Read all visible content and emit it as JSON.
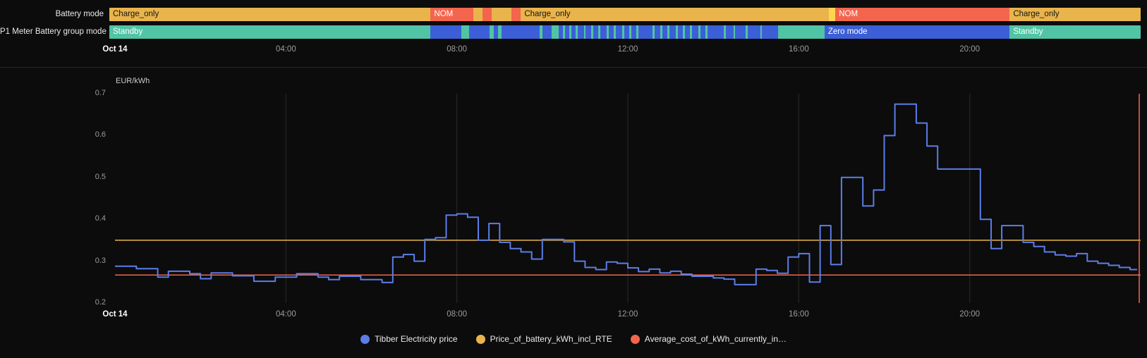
{
  "colors": {
    "background": "#0c0c0c",
    "amber": "#e9b44c",
    "amber_bright": "#ffd54f",
    "red": "#f3654d",
    "teal": "#50c4a4",
    "blue": "#3c5fd7",
    "price_line": "#5b7de8",
    "grid": "#2a2a2a",
    "axis_text": "#9c9c9c",
    "bright_text": "#ffffff"
  },
  "timelines": [
    {
      "label": "Battery mode",
      "segments": [
        {
          "s": 0,
          "e": 31.15,
          "c": "amber",
          "label": "Charge_only",
          "dark": true
        },
        {
          "s": 31.15,
          "e": 35.3,
          "c": "red",
          "label": "NOM"
        },
        {
          "s": 35.3,
          "e": 36.2,
          "c": "amber"
        },
        {
          "s": 36.2,
          "e": 37.1,
          "c": "red"
        },
        {
          "s": 37.1,
          "e": 39,
          "c": "amber"
        },
        {
          "s": 39,
          "e": 39.9,
          "c": "red"
        },
        {
          "s": 39.9,
          "e": 69.8,
          "c": "amber",
          "label": "Charge_only",
          "dark": true
        },
        {
          "s": 69.8,
          "e": 70.4,
          "c": "amber_bright"
        },
        {
          "s": 70.4,
          "e": 87.3,
          "c": "red",
          "label": "NOM"
        },
        {
          "s": 87.3,
          "e": 100,
          "c": "amber",
          "label": "Charge_only",
          "dark": true
        }
      ]
    },
    {
      "label": "P1 Meter Battery group mode",
      "segments": [
        {
          "s": 0,
          "e": 31.15,
          "c": "teal",
          "label": "Standby"
        },
        {
          "s": 31.15,
          "e": 64.85,
          "c": "blue"
        },
        {
          "s": 64.85,
          "e": 69.35,
          "c": "teal"
        },
        {
          "s": 69.35,
          "e": 87.3,
          "c": "blue",
          "label": "Zero mode"
        },
        {
          "s": 87.3,
          "e": 100,
          "c": "teal",
          "label": "Standby"
        }
      ],
      "stripes": [
        [
          34.1,
          34.9
        ],
        [
          36.9,
          37.3
        ],
        [
          37.7,
          38.0
        ],
        [
          41.7,
          42.0
        ],
        [
          42.9,
          43.6
        ],
        [
          44.0,
          44.2
        ],
        [
          44.6,
          44.8
        ],
        [
          45.2,
          45.4
        ],
        [
          46.0,
          46.2
        ],
        [
          46.7,
          46.9
        ],
        [
          47.4,
          47.6
        ],
        [
          48.2,
          48.4
        ],
        [
          48.9,
          49.1
        ],
        [
          49.7,
          49.9
        ],
        [
          50.4,
          50.6
        ],
        [
          51.1,
          51.3
        ],
        [
          52.7,
          52.9
        ],
        [
          53.4,
          53.6
        ],
        [
          54.1,
          54.3
        ],
        [
          54.9,
          55.1
        ],
        [
          55.6,
          55.8
        ],
        [
          56.3,
          56.5
        ],
        [
          57.1,
          57.3
        ],
        [
          57.8,
          58.0
        ],
        [
          59.6,
          59.8
        ],
        [
          60.5,
          60.7
        ],
        [
          61.7,
          61.9
        ],
        [
          63.1,
          63.3
        ]
      ]
    }
  ],
  "time_axis": {
    "ticks": [
      {
        "pos": 0,
        "label": "Oct 14",
        "bold": true
      },
      {
        "pos": 16.667,
        "label": "04:00"
      },
      {
        "pos": 33.333,
        "label": "08:00"
      },
      {
        "pos": 50,
        "label": "12:00"
      },
      {
        "pos": 66.667,
        "label": "16:00"
      },
      {
        "pos": 83.333,
        "label": "20:00"
      }
    ]
  },
  "chart_data": {
    "type": "line",
    "step": true,
    "ylabel": "EUR/kWh",
    "ylim": [
      0.2,
      0.7
    ],
    "y_ticks": [
      "0.7",
      "0.6",
      "0.5",
      "0.4",
      "0.3",
      "0.2"
    ],
    "x_range_hours": [
      0,
      24
    ],
    "grid": "vertical-only",
    "legend_position": "bottom-center",
    "x_ticks": [
      {
        "pos": 0,
        "label": "Oct 14",
        "bold": true
      },
      {
        "pos": 16.667,
        "label": "04:00"
      },
      {
        "pos": 33.333,
        "label": "08:00"
      },
      {
        "pos": 50,
        "label": "12:00"
      },
      {
        "pos": 66.667,
        "label": "16:00"
      },
      {
        "pos": 83.333,
        "label": "20:00"
      }
    ],
    "series": [
      {
        "name": "Tibber Electricity price",
        "color": "price_line",
        "kind": "step",
        "points": [
          [
            0,
            0.288
          ],
          [
            0.5,
            0.282
          ],
          [
            1,
            0.262
          ],
          [
            1.25,
            0.276
          ],
          [
            1.75,
            0.27
          ],
          [
            2,
            0.258
          ],
          [
            2.25,
            0.272
          ],
          [
            2.75,
            0.265
          ],
          [
            3.25,
            0.252
          ],
          [
            3.75,
            0.262
          ],
          [
            4.25,
            0.27
          ],
          [
            4.75,
            0.262
          ],
          [
            5,
            0.256
          ],
          [
            5.25,
            0.264
          ],
          [
            5.75,
            0.256
          ],
          [
            6.25,
            0.249
          ],
          [
            6.5,
            0.31
          ],
          [
            6.75,
            0.316
          ],
          [
            7,
            0.3
          ],
          [
            7.25,
            0.352
          ],
          [
            7.5,
            0.356
          ],
          [
            7.75,
            0.41
          ],
          [
            8,
            0.413
          ],
          [
            8.25,
            0.405
          ],
          [
            8.5,
            0.35
          ],
          [
            8.75,
            0.39
          ],
          [
            9,
            0.345
          ],
          [
            9.25,
            0.33
          ],
          [
            9.5,
            0.322
          ],
          [
            9.75,
            0.305
          ],
          [
            10,
            0.352
          ],
          [
            10.5,
            0.346
          ],
          [
            10.75,
            0.3
          ],
          [
            11,
            0.285
          ],
          [
            11.25,
            0.28
          ],
          [
            11.5,
            0.298
          ],
          [
            11.75,
            0.295
          ],
          [
            12,
            0.284
          ],
          [
            12.25,
            0.275
          ],
          [
            12.5,
            0.281
          ],
          [
            12.75,
            0.272
          ],
          [
            13,
            0.276
          ],
          [
            13.25,
            0.269
          ],
          [
            13.5,
            0.264
          ],
          [
            14,
            0.26
          ],
          [
            14.25,
            0.257
          ],
          [
            14.5,
            0.244
          ],
          [
            15,
            0.281
          ],
          [
            15.25,
            0.278
          ],
          [
            15.5,
            0.271
          ],
          [
            15.75,
            0.31
          ],
          [
            16,
            0.318
          ],
          [
            16.25,
            0.25
          ],
          [
            16.5,
            0.385
          ],
          [
            16.75,
            0.292
          ],
          [
            17,
            0.5
          ],
          [
            17.5,
            0.432
          ],
          [
            17.75,
            0.47
          ],
          [
            18,
            0.6
          ],
          [
            18.25,
            0.675
          ],
          [
            18.75,
            0.63
          ],
          [
            19,
            0.575
          ],
          [
            19.25,
            0.52
          ],
          [
            20.25,
            0.4
          ],
          [
            20.5,
            0.33
          ],
          [
            20.75,
            0.385
          ],
          [
            21.25,
            0.345
          ],
          [
            21.5,
            0.335
          ],
          [
            21.75,
            0.322
          ],
          [
            22,
            0.315
          ],
          [
            22.25,
            0.312
          ],
          [
            22.5,
            0.318
          ],
          [
            22.75,
            0.3
          ],
          [
            23,
            0.295
          ],
          [
            23.25,
            0.29
          ],
          [
            23.5,
            0.285
          ],
          [
            23.75,
            0.28
          ]
        ]
      },
      {
        "name": "Price_of_battery_kWh_incl_RTE",
        "color": "amber",
        "kind": "hline",
        "value": 0.35
      },
      {
        "name": "Average_cost_of_kWh_currently_in…",
        "color": "red",
        "kind": "hline",
        "value": 0.267
      }
    ],
    "now_line": {
      "color": "red"
    }
  }
}
